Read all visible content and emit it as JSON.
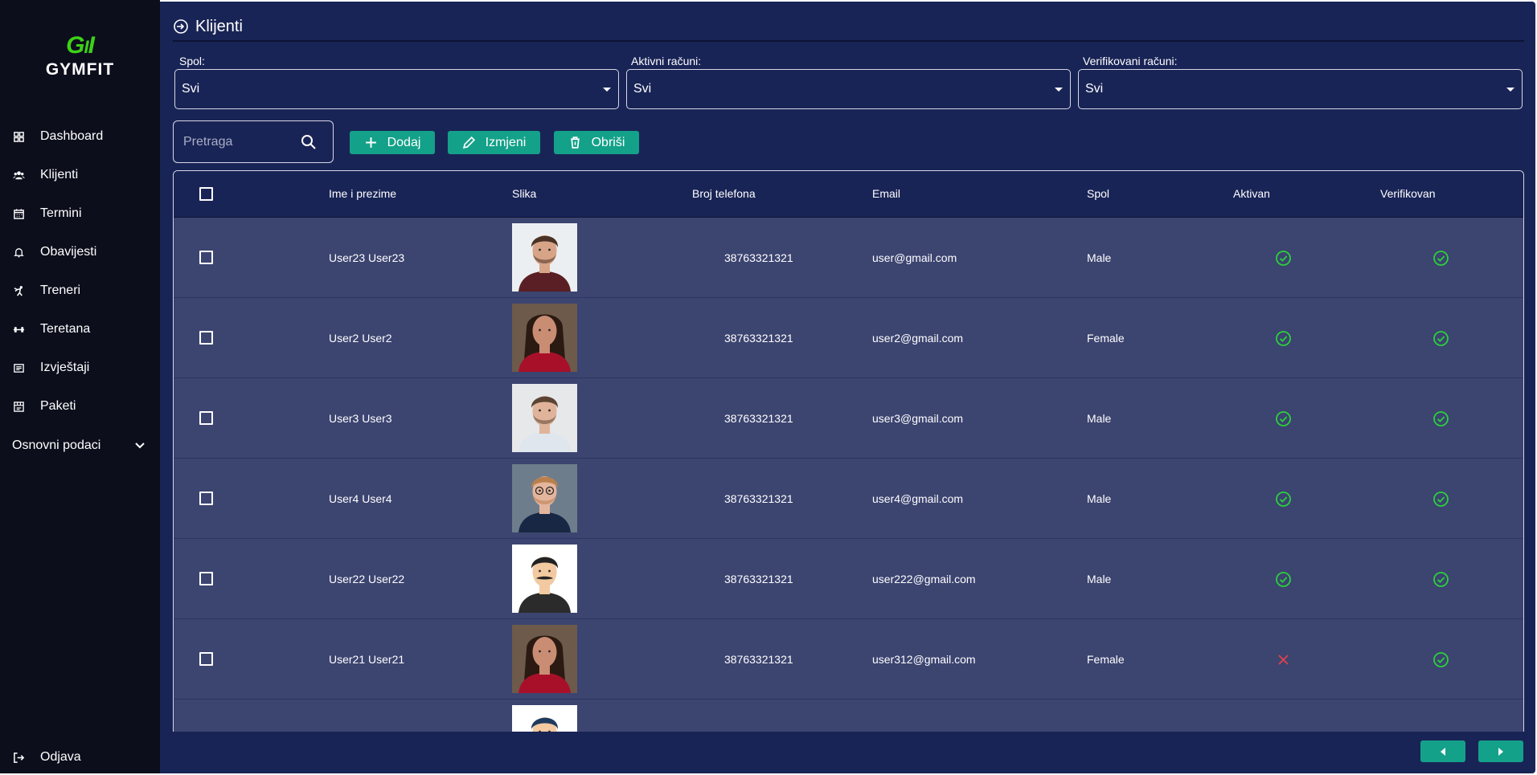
{
  "brand": {
    "mark": "GYMFIT",
    "name": "GYMFIT",
    "mark_color": "#3cd217"
  },
  "sidebar": {
    "items": [
      {
        "label": "Dashboard",
        "icon": "dashboard-icon"
      },
      {
        "label": "Klijenti",
        "icon": "users-icon"
      },
      {
        "label": "Termini",
        "icon": "calendar-icon"
      },
      {
        "label": "Obavijesti",
        "icon": "bell-icon"
      },
      {
        "label": "Treneri",
        "icon": "trainer-icon"
      },
      {
        "label": "Teretana",
        "icon": "dumbbell-icon"
      },
      {
        "label": "Izvještaji",
        "icon": "report-icon"
      },
      {
        "label": "Paketi",
        "icon": "package-icon"
      }
    ],
    "group": {
      "label": "Osnovni podaci",
      "icon": "chevron-down-icon"
    },
    "logout": {
      "label": "Odjava",
      "icon": "logout-icon"
    }
  },
  "page": {
    "title": "Klijenti",
    "icon": "login-icon"
  },
  "filters": [
    {
      "label": "Spol:",
      "value": "Svi"
    },
    {
      "label": "Aktivni računi:",
      "value": "Svi"
    },
    {
      "label": "Verifikovani računi:",
      "value": "Svi"
    }
  ],
  "search": {
    "placeholder": "Pretraga",
    "icon": "search-icon"
  },
  "toolbar": {
    "add_label": "Dodaj",
    "edit_label": "Izmjeni",
    "delete_label": "Obriši"
  },
  "table": {
    "columns": [
      "Ime i prezime",
      "Slika",
      "Broj telefona",
      "Email",
      "Spol",
      "Aktivan",
      "Verifikovan"
    ],
    "rows": [
      {
        "name": "User23 User23",
        "phone": "38763321321",
        "email": "user@gmail.com",
        "gender": "Male",
        "active": true,
        "verified": true
      },
      {
        "name": "User2 User2",
        "phone": "38763321321",
        "email": "user2@gmail.com",
        "gender": "Female",
        "active": true,
        "verified": true
      },
      {
        "name": "User3 User3",
        "phone": "38763321321",
        "email": "user3@gmail.com",
        "gender": "Male",
        "active": true,
        "verified": true
      },
      {
        "name": "User4 User4",
        "phone": "38763321321",
        "email": "user4@gmail.com",
        "gender": "Male",
        "active": true,
        "verified": true
      },
      {
        "name": "User22 User22",
        "phone": "38763321321",
        "email": "user222@gmail.com",
        "gender": "Male",
        "active": true,
        "verified": true
      },
      {
        "name": "User21 User21",
        "phone": "38763321321",
        "email": "user312@gmail.com",
        "gender": "Female",
        "active": false,
        "verified": true
      },
      {
        "name": "",
        "phone": "",
        "email": "",
        "gender": "",
        "active": true,
        "verified": true
      }
    ]
  },
  "pagination": {
    "prev_icon": "arrow-left-icon",
    "next_icon": "arrow-right-icon"
  },
  "colors": {
    "sidebar": "#0c0e1c",
    "main": "#192456",
    "row": "#3c4470",
    "accent": "#14a189",
    "ok": "#2bd13c",
    "error": "#e2424a"
  }
}
